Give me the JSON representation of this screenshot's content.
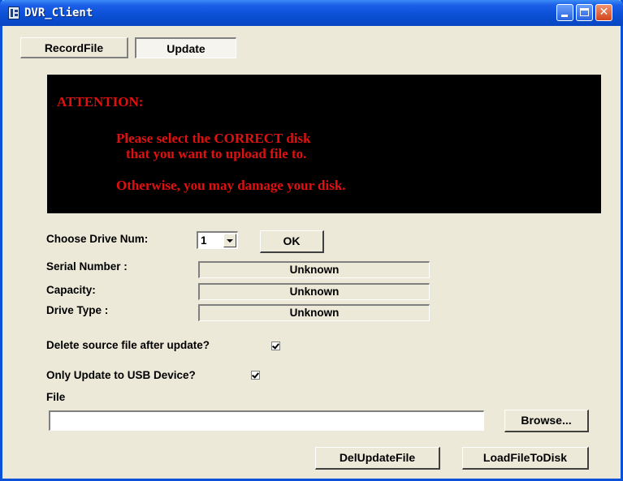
{
  "window": {
    "title": "DVR_Client"
  },
  "tabs": [
    {
      "label": "RecordFile"
    },
    {
      "label": "Update"
    }
  ],
  "attention": {
    "title": "ATTENTION:",
    "line1": "Please select the CORRECT disk",
    "line2": "that you want to upload file to.",
    "line3": "Otherwise, you may damage your disk."
  },
  "drive": {
    "label": "Choose Drive Num:",
    "selected": "1",
    "ok_label": "OK"
  },
  "info": {
    "serial_label": "Serial Number :",
    "serial_value": "Unknown",
    "capacity_label": "Capacity:",
    "capacity_value": "Unknown",
    "type_label": "Drive Type :",
    "type_value": "Unknown"
  },
  "options": {
    "delete_source_label": "Delete source file after update?",
    "delete_source_checked": true,
    "usb_only_label": "Only Update to USB Device?",
    "usb_only_checked": true
  },
  "file": {
    "label": "File",
    "value": "",
    "browse_label": "Browse..."
  },
  "actions": {
    "del_label": "DelUpdateFile",
    "load_label": "LoadFileToDisk"
  },
  "colors": {
    "titlebar": "#0a4fd4",
    "window_bg": "#ece9d8",
    "attention_bg": "#000000",
    "attention_text": "#e01010"
  }
}
